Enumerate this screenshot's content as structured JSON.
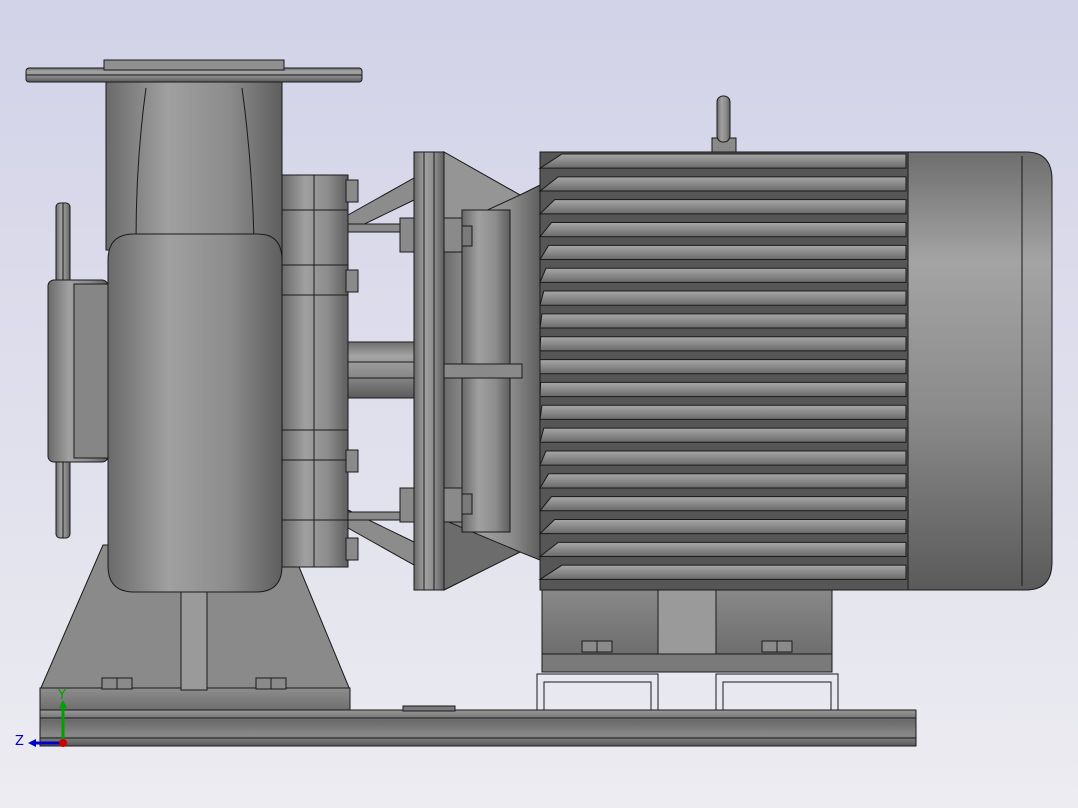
{
  "colors": {
    "bg_top": "#d2d2e8",
    "bg_bottom": "#ececf1",
    "metal_light": "#9c9c9c",
    "metal_mid": "#7c7c7c",
    "metal_dark": "#4a4a4a",
    "outline": "#1a1a1a",
    "axis_x": "#cc0000",
    "axis_y": "#00a000",
    "axis_z": "#0000cc"
  },
  "triad": {
    "y_label": "Y",
    "z_label": "Z"
  }
}
